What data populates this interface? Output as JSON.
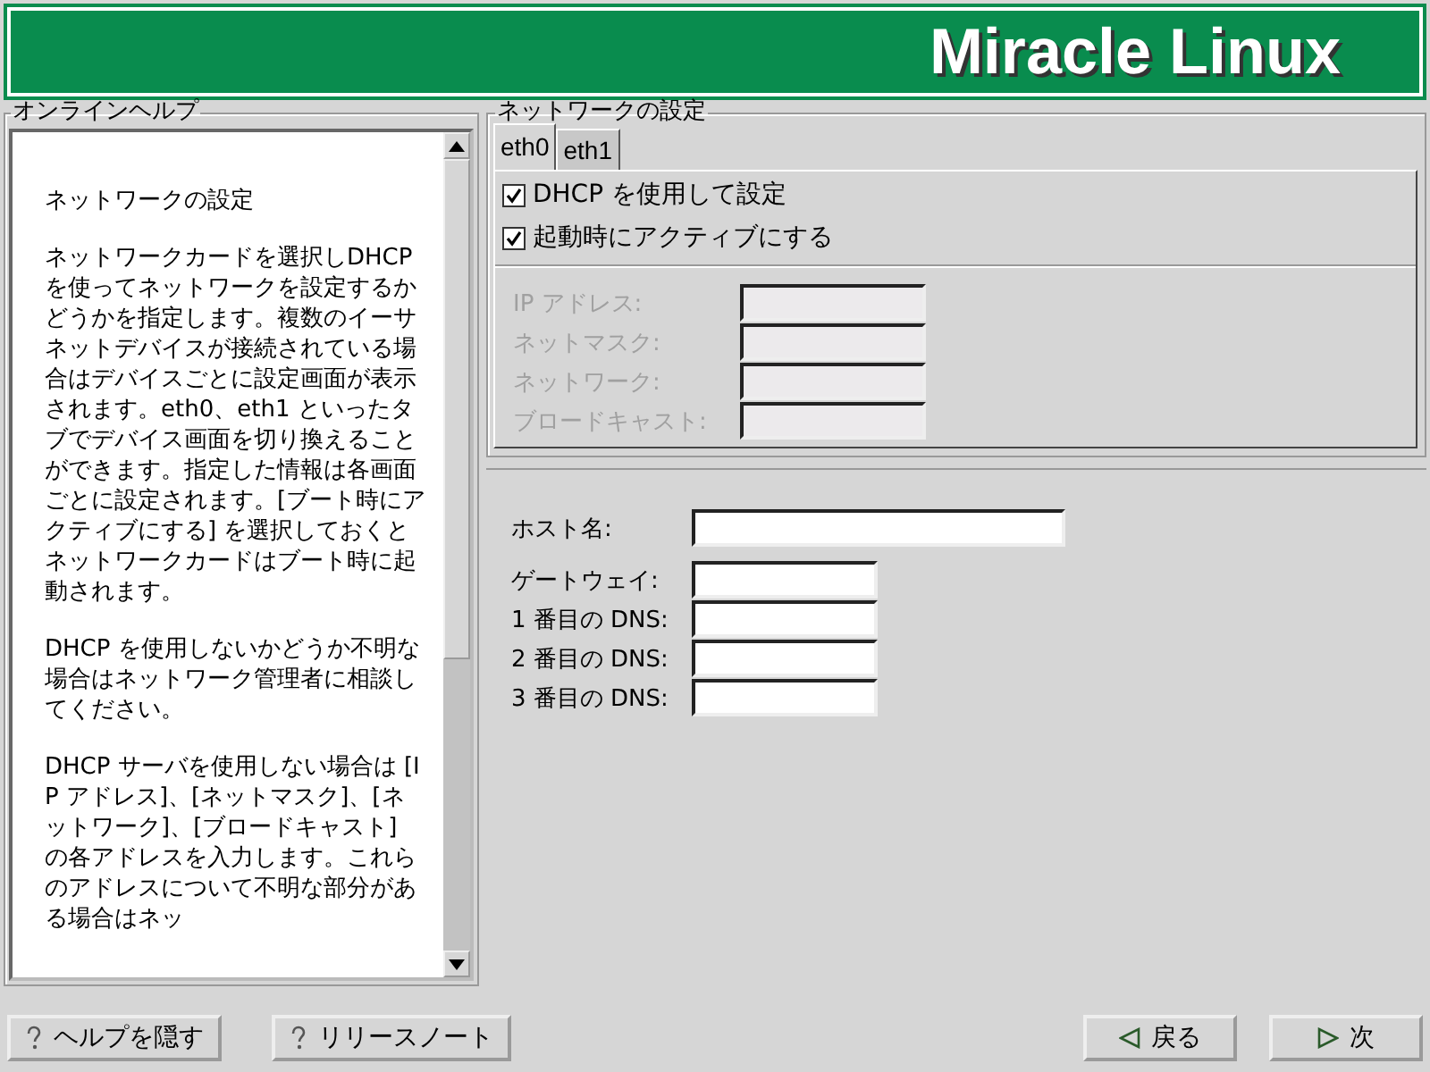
{
  "banner": {
    "title": "Miracle Linux"
  },
  "help": {
    "title": "オンラインヘルプ",
    "paragraphs": [
      "ネットワークの設定",
      "ネットワークカードを選択しDHCP を使ってネットワークを設定するかどうかを指定します。複数のイーサネットデバイスが接続されている場合はデバイスごとに設定画面が表示されます。eth0、eth1 といったタブでデバイス画面を切り換えることができます。指定した情報は各画面ごとに設定されます。[ブート時にアクティブにする] を選択しておくとネットワークカードはブート時に起動されます。",
      "DHCP を使用しないかどうか不明な場合はネットワーク管理者に相談してください。",
      "DHCP サーバを使用しない場合は [IP アドレス]、[ネットマスク]、[ネットワーク]、[ブロードキャスト] の各アドレスを入力します。これらのアドレスについて不明な部分がある場合はネッ"
    ]
  },
  "network": {
    "title": "ネットワークの設定",
    "tabs": [
      {
        "label": "eth0",
        "selected": true
      },
      {
        "label": "eth1",
        "selected": false
      }
    ],
    "checkboxes": [
      {
        "label": "DHCP を使用して設定",
        "checked": true
      },
      {
        "label": "起動時にアクティブにする",
        "checked": true
      }
    ],
    "device_fields": [
      {
        "label": "IP アドレス:",
        "disabled": true
      },
      {
        "label": "ネットマスク:",
        "disabled": true
      },
      {
        "label": "ネットワーク:",
        "disabled": true
      },
      {
        "label": "ブロードキャスト:",
        "disabled": true
      }
    ],
    "host_fields": [
      {
        "label": "ホスト名:",
        "kind": "wide"
      },
      {
        "label": "ゲートウェイ:",
        "kind": "short"
      },
      {
        "label": "1 番目の DNS:",
        "kind": "short"
      },
      {
        "label": "2 番目の DNS:",
        "kind": "short"
      },
      {
        "label": "3 番目の DNS:",
        "kind": "short"
      }
    ]
  },
  "buttons_left": [
    {
      "label": "ヘルプを隠す"
    },
    {
      "label": "リリースノート"
    }
  ],
  "buttons_right": [
    {
      "label": "戻る",
      "kind": "back"
    },
    {
      "label": "次",
      "kind": "next"
    }
  ]
}
